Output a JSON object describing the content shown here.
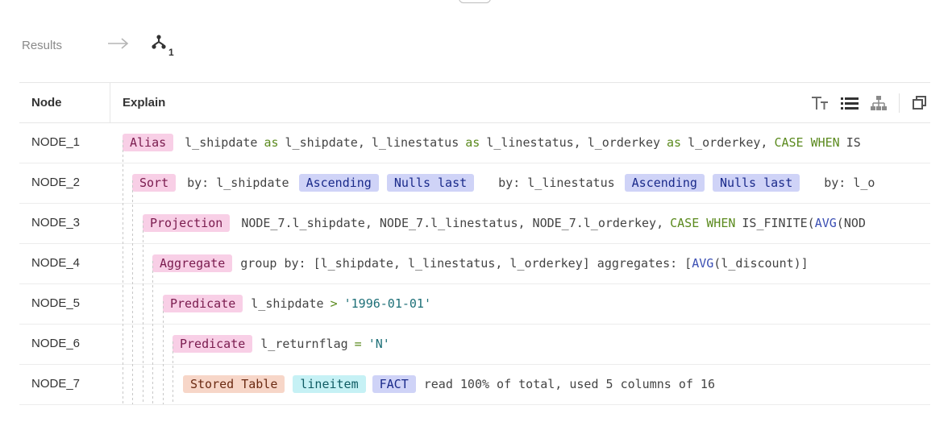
{
  "breadcrumb": {
    "results_label": "Results",
    "node_count": "1"
  },
  "table": {
    "header": {
      "node": "Node",
      "explain": "Explain"
    },
    "toolbar": {
      "icons": [
        "text-size-icon",
        "list-view-icon",
        "tree-view-icon",
        "copy-icon"
      ]
    },
    "rows": [
      {
        "id": "NODE_1",
        "tag": "Alias",
        "a": "l_shipdate",
        "b": "as",
        "c": "l_shipdate,",
        "d": "l_linestatus",
        "e": "as",
        "f": "l_linestatus,",
        "g": "l_orderkey",
        "h": "as",
        "i": "l_orderkey,",
        "j": "CASE WHEN",
        "k": "IS"
      },
      {
        "id": "NODE_2",
        "tag": "Sort",
        "by1": "by: l_shipdate",
        "asc1": "Ascending",
        "nl1": "Nulls last",
        "by2": "by: l_linestatus",
        "asc2": "Ascending",
        "nl2": "Nulls last",
        "by3": "by: l_o"
      },
      {
        "id": "NODE_3",
        "tag": "Projection",
        "a": "NODE_7.l_shipdate, NODE_7.l_linestatus, NODE_7.l_orderkey,",
        "b": "CASE WHEN",
        "c": "IS_FINITE(",
        "d": "AVG",
        "e": "(NOD"
      },
      {
        "id": "NODE_4",
        "tag": "Aggregate",
        "a": "group by: [l_shipdate, l_linestatus, l_orderkey] aggregates: [",
        "b": "AVG",
        "c": "(l_discount)]"
      },
      {
        "id": "NODE_5",
        "tag": "Predicate",
        "a": "l_shipdate",
        "b": ">",
        "c": "'1996-01-01'"
      },
      {
        "id": "NODE_6",
        "tag": "Predicate",
        "a": "l_returnflag",
        "b": "=",
        "c": "'N'"
      },
      {
        "id": "NODE_7",
        "tag": "Stored Table",
        "table": "lineitem",
        "kind": "FACT",
        "a": "read 100% of total, used 5 columns of 16"
      }
    ]
  }
}
